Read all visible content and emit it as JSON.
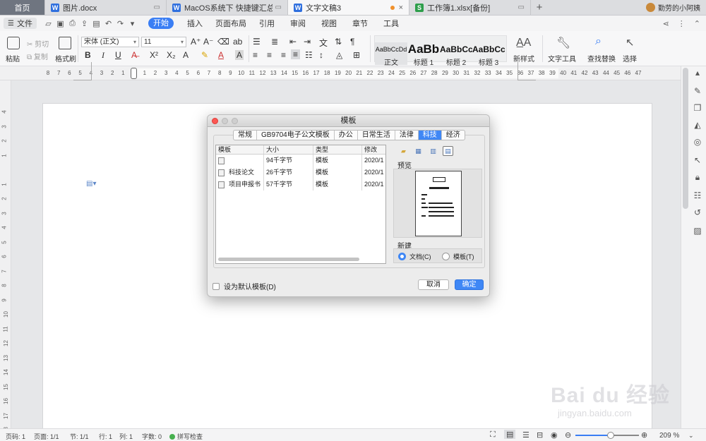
{
  "tabs": {
    "home": "首页",
    "items": [
      {
        "title": "图片.docx",
        "type": "w"
      },
      {
        "title": "MacOS系统下 快捷键汇总",
        "type": "w"
      },
      {
        "title": "文字文稿3",
        "type": "w",
        "active": true
      },
      {
        "title": "工作簿1.xlsx[备份]",
        "type": "s"
      }
    ],
    "add": "+",
    "user": "勤劳的小阿姨"
  },
  "menu": {
    "file": "文件",
    "items": [
      "开始",
      "插入",
      "页面布局",
      "引用",
      "审阅",
      "视图",
      "章节",
      "工具"
    ],
    "active_index": 0
  },
  "ribbon": {
    "paste": "粘贴",
    "cut": "剪切",
    "copy": "复制",
    "format_painter": "格式刷",
    "font_name": "宋体 (正文)",
    "font_size": "11",
    "styles": [
      {
        "sample": "AaBbCcDd",
        "label": "正文"
      },
      {
        "sample": "AaBb",
        "label": "标题 1"
      },
      {
        "sample": "AaBbCc",
        "label": "标题 2"
      },
      {
        "sample": "AaBbCc",
        "label": "标题 3"
      }
    ],
    "new_style": "新样式",
    "text_tools": "文字工具",
    "find_replace": "查找替换",
    "select": "选择"
  },
  "ruler": {
    "ticks": [
      "8",
      "7",
      "6",
      "5",
      "4",
      "3",
      "2",
      "1",
      "",
      "1",
      "2",
      "3",
      "4",
      "5",
      "6",
      "7",
      "8",
      "9",
      "10",
      "11",
      "12",
      "13",
      "14",
      "15",
      "16",
      "17",
      "18",
      "19",
      "20",
      "21",
      "22",
      "23",
      "24",
      "25",
      "26",
      "27",
      "28",
      "29",
      "30",
      "31",
      "32",
      "33",
      "34",
      "35",
      "36",
      "37",
      "38",
      "39",
      "40",
      "41",
      "42",
      "43",
      "44",
      "45",
      "46",
      "47"
    ]
  },
  "vruler": {
    "ticks": [
      "4",
      "3",
      "2",
      "1",
      "",
      "1",
      "2",
      "3",
      "4",
      "5",
      "6",
      "7",
      "8",
      "9",
      "10",
      "11",
      "12",
      "13",
      "14",
      "15",
      "16",
      "17",
      "18",
      "19"
    ]
  },
  "dialog": {
    "title": "模板",
    "tabs": [
      "常规",
      "GB9704电子公文模板",
      "办公",
      "日常生活",
      "法律",
      "科技",
      "经济"
    ],
    "selected_tab": 5,
    "columns": [
      "模板",
      "大小",
      "类型",
      "修改"
    ],
    "rows": [
      {
        "name": "",
        "size": "94千字节",
        "type": "模板",
        "modified": "2020/1"
      },
      {
        "name": "科技论文",
        "size": "26千字节",
        "type": "模板",
        "modified": "2020/1"
      },
      {
        "name": "项目申报书",
        "size": "57千字节",
        "type": "模板",
        "modified": "2020/1"
      }
    ],
    "preview_label": "预览",
    "new_label": "新建",
    "radio_doc": "文档(C)",
    "radio_template": "模板(T)",
    "default_checkbox": "设为默认模板(D)",
    "cancel": "取消",
    "ok": "确定"
  },
  "statusbar": {
    "page_code": "页码: 1",
    "pages": "页面: 1/1",
    "section": "节: 1/1",
    "row": "行: 1",
    "col": "列: 1",
    "words": "字数: 0",
    "spell": "拼写检查",
    "zoom": "209 %",
    "zoom_level": 0.55
  },
  "watermark": {
    "main": "Bai du 经验",
    "sub": "jingyan.baidu.com"
  },
  "colors": {
    "accent": "#3f87f5",
    "active_tab_dot": "#f0902b"
  }
}
